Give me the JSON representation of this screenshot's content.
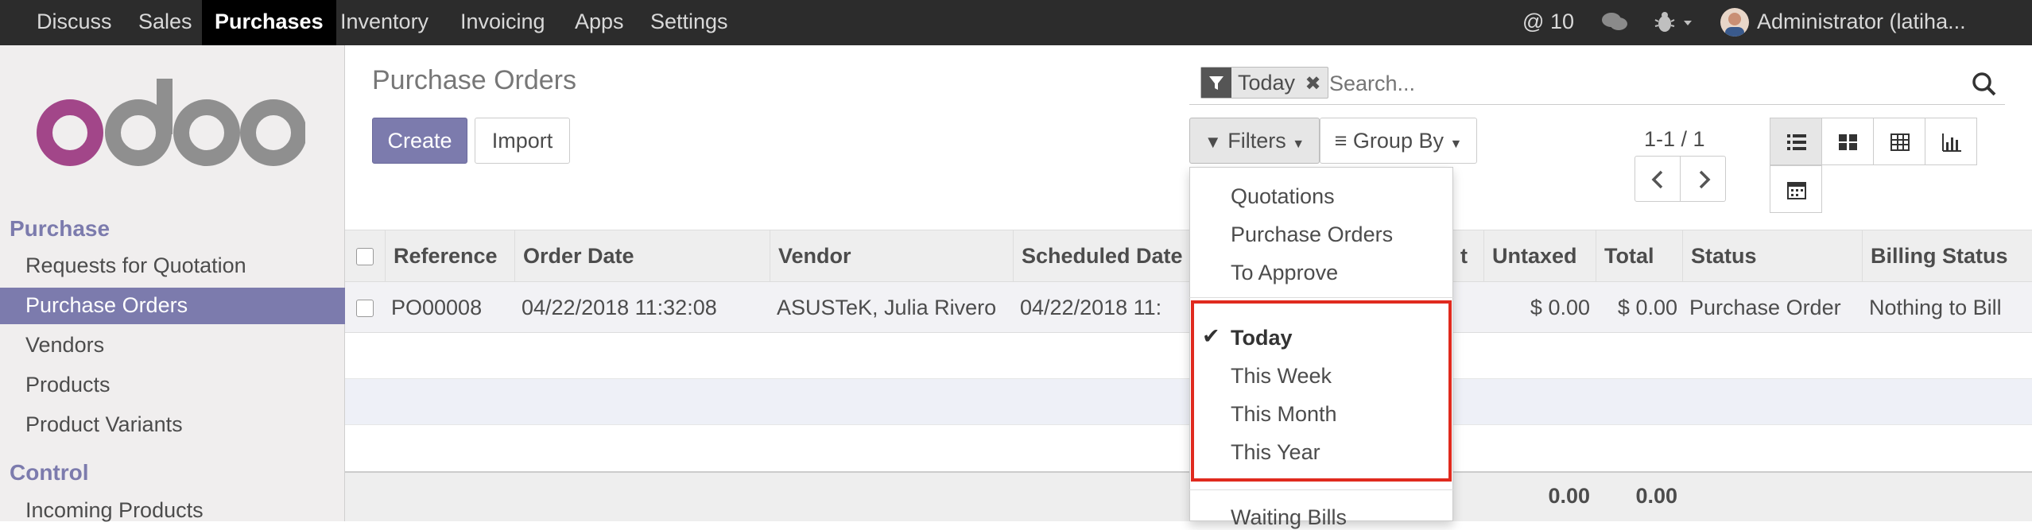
{
  "topbar": {
    "menu": [
      {
        "label": "Discuss"
      },
      {
        "label": "Sales"
      },
      {
        "label": "Purchases"
      },
      {
        "label": "Inventory"
      },
      {
        "label": "Invoicing"
      },
      {
        "label": "Apps"
      },
      {
        "label": "Settings"
      }
    ],
    "active": "Purchases",
    "mentions_count": "10",
    "user_name": "Administrator (latiha..."
  },
  "sidebar": {
    "logo_text": "odoo",
    "sections": [
      {
        "title": "Purchase",
        "items": [
          "Requests for Quotation",
          "Purchase Orders",
          "Vendors",
          "Products",
          "Product Variants"
        ]
      },
      {
        "title": "Control",
        "items": [
          "Incoming Products"
        ]
      }
    ],
    "active_item": "Purchase Orders"
  },
  "page": {
    "title": "Purchase Orders",
    "create_label": "Create",
    "import_label": "Import"
  },
  "search": {
    "facet_label": "Today",
    "placeholder": "Search..."
  },
  "controls": {
    "filters_label": "Filters",
    "groupby_label": "Group By",
    "pager": "1-1 / 1"
  },
  "filters_menu": {
    "group1": [
      "Quotations",
      "Purchase Orders",
      "To Approve"
    ],
    "group2": [
      "Today",
      "This Week",
      "This Month",
      "This Year"
    ],
    "checked": "Today",
    "group3": [
      "Waiting Bills"
    ]
  },
  "table": {
    "columns": [
      "Reference",
      "Order Date",
      "Vendor",
      "Scheduled Date",
      "t",
      "Untaxed",
      "Total",
      "Status",
      "Billing Status"
    ],
    "rows": [
      {
        "reference": "PO00008",
        "order_date": "04/22/2018 11:32:08",
        "vendor": "ASUSTeK, Julia Rivero",
        "scheduled_date": "04/22/2018 11:",
        "untaxed": "$ 0.00",
        "total": "$ 0.00",
        "status": "Purchase Order",
        "billing_status": "Nothing to Bill"
      }
    ],
    "footer": {
      "untaxed": "0.00",
      "total": "0.00"
    }
  },
  "colors": {
    "accent": "#7c7bad",
    "topbar": "#2c2c2c",
    "highlight_border": "#e02a1e"
  }
}
